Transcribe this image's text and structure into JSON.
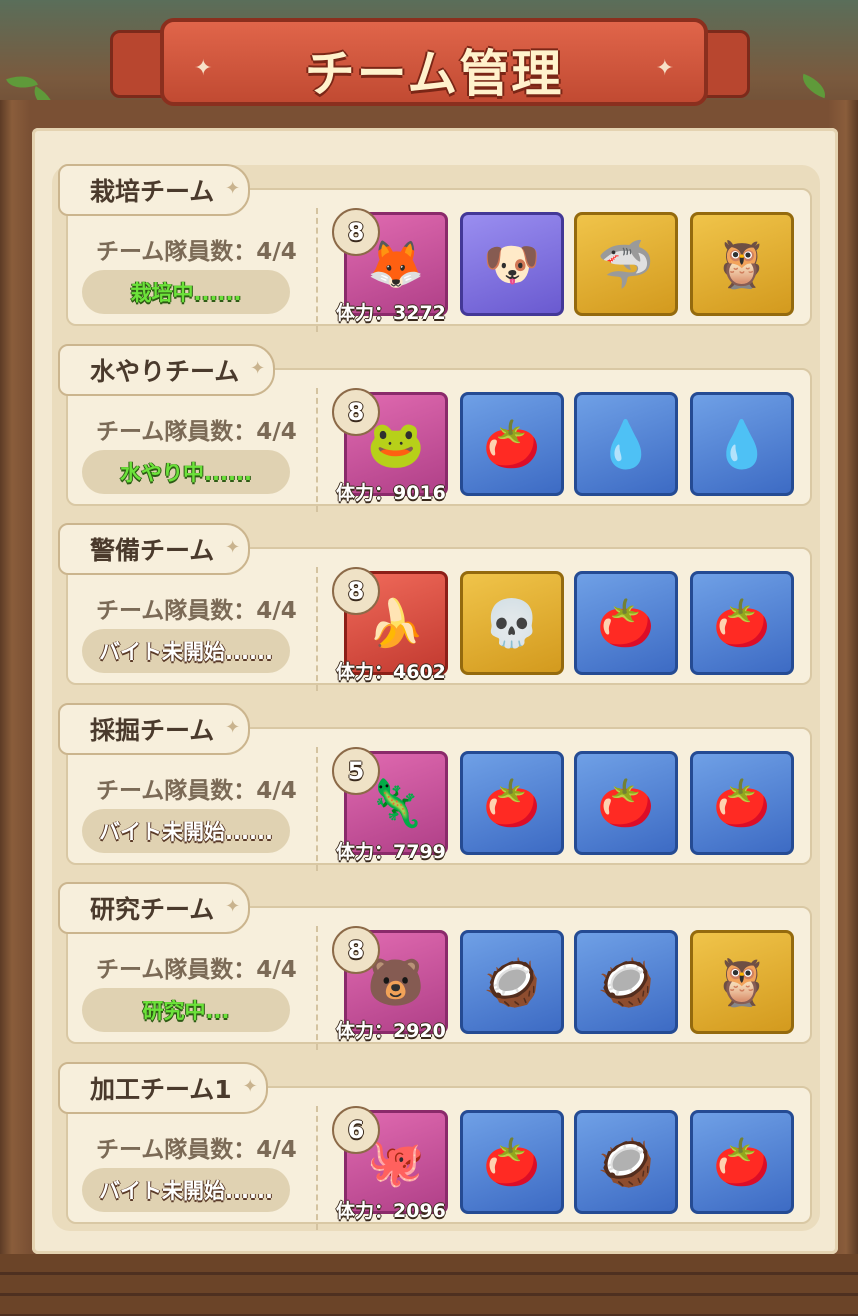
{
  "title": "チーム管理",
  "teams": [
    {
      "name": "栽培チーム",
      "members": "チーム隊員数：4/4",
      "status": "栽培中......",
      "level": "8",
      "hp": "体力：3272",
      "slots": [
        {
          "icon": "fox-mask-character-icon",
          "glyph": "🦊",
          "frame": "pink"
        },
        {
          "icon": "winged-dog-character-icon",
          "glyph": "🐶",
          "frame": "purple"
        },
        {
          "icon": "shark-armor-character-icon",
          "glyph": "🦈",
          "frame": "gold"
        },
        {
          "icon": "owl-robot-character-icon",
          "glyph": "🦉",
          "frame": "gold"
        }
      ]
    },
    {
      "name": "水やりチーム",
      "members": "チーム隊員数：4/4",
      "status": "水やり中......",
      "level": "8",
      "hp": "体力：9016",
      "slots": [
        {
          "icon": "frog-cap-character-icon",
          "glyph": "🐸",
          "frame": "pink"
        },
        {
          "icon": "tomato-dish-icon",
          "glyph": "🍅",
          "frame": "blue"
        },
        {
          "icon": "water-spirit-icon",
          "glyph": "💧",
          "frame": "blue"
        },
        {
          "icon": "water-spirit-icon",
          "glyph": "💧",
          "frame": "blue"
        }
      ]
    },
    {
      "name": "警備チーム",
      "members": "チーム隊員数：4/4",
      "status": "バイト未開始......",
      "level": "8",
      "hp": "体力：4602",
      "slots": [
        {
          "icon": "banana-boxer-character-icon",
          "glyph": "🍌",
          "frame": "red"
        },
        {
          "icon": "skull-demon-character-icon",
          "glyph": "💀",
          "frame": "gold"
        },
        {
          "icon": "tomato-dish-icon",
          "glyph": "🍅",
          "frame": "blue"
        },
        {
          "icon": "tomato-dish-icon",
          "glyph": "🍅",
          "frame": "blue"
        }
      ]
    },
    {
      "name": "採掘チーム",
      "members": "チーム隊員数：4/4",
      "status": "バイト未開始......",
      "level": "5",
      "hp": "体力：7799",
      "slots": [
        {
          "icon": "gecko-miner-character-icon",
          "glyph": "🦎",
          "frame": "pink"
        },
        {
          "icon": "tomato-dish-icon",
          "glyph": "🍅",
          "frame": "blue"
        },
        {
          "icon": "tomato-dish-icon",
          "glyph": "🍅",
          "frame": "blue"
        },
        {
          "icon": "tomato-dish-icon",
          "glyph": "🍅",
          "frame": "blue"
        }
      ]
    },
    {
      "name": "研究チーム",
      "members": "チーム隊員数：4/4",
      "status": "研究中...",
      "level": "8",
      "hp": "体力：2920",
      "slots": [
        {
          "icon": "goggle-bear-character-icon",
          "glyph": "🐻",
          "frame": "pink"
        },
        {
          "icon": "coconut-drink-icon",
          "glyph": "🥥",
          "frame": "blue"
        },
        {
          "icon": "coconut-drink-icon",
          "glyph": "🥥",
          "frame": "blue"
        },
        {
          "icon": "owl-robot-character-icon",
          "glyph": "🦉",
          "frame": "gold"
        }
      ]
    },
    {
      "name": "加工チーム1",
      "members": "チーム隊員数：4/4",
      "status": "バイト未開始......",
      "level": "6",
      "hp": "体力：2096",
      "slots": [
        {
          "icon": "pirate-octopus-character-icon",
          "glyph": "🐙",
          "frame": "pink"
        },
        {
          "icon": "tomato-dish-icon",
          "glyph": "🍅",
          "frame": "blue"
        },
        {
          "icon": "coconut-drink-icon",
          "glyph": "🥥",
          "frame": "blue"
        },
        {
          "icon": "tomato-dish-icon",
          "glyph": "🍅",
          "frame": "blue"
        }
      ]
    }
  ]
}
